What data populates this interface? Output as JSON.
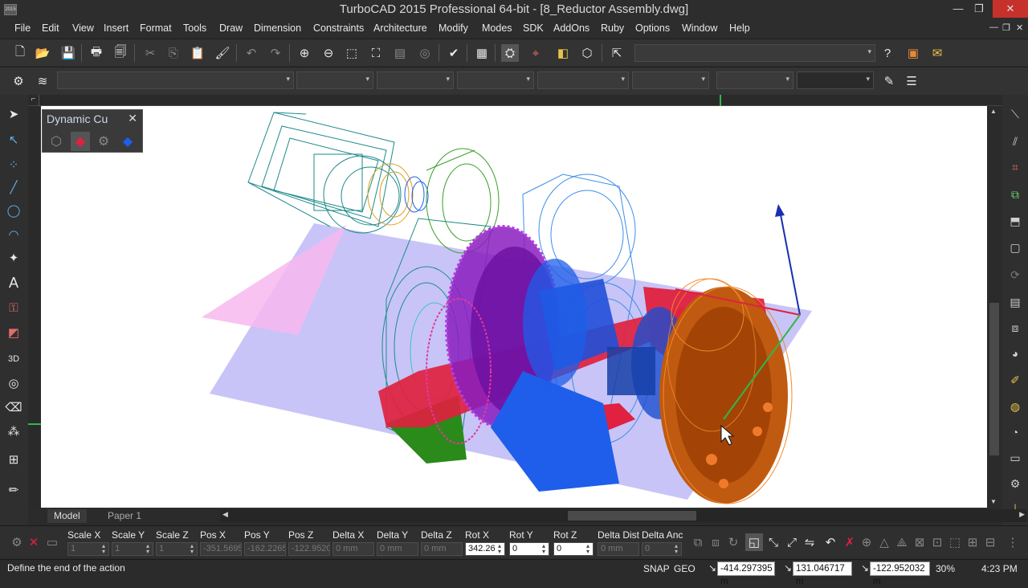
{
  "window": {
    "title": "TurboCAD 2015 Professional 64-bit - [8_Reductor Assembly.dwg]",
    "app_icon_text": "2015",
    "minimize": "—",
    "maximize": "❐",
    "close": "✕"
  },
  "menu": {
    "items": [
      "File",
      "Edit",
      "View",
      "Insert",
      "Format",
      "Tools",
      "Draw",
      "Dimension",
      "Constraints",
      "Architecture",
      "Modify",
      "Modes",
      "SDK",
      "AddOns",
      "Ruby",
      "Options",
      "Window",
      "Help"
    ],
    "mdi_minimize": "—",
    "mdi_restore": "❐",
    "mdi_close": "✕"
  },
  "palette": {
    "title": "Dynamic Cu",
    "close": "✕"
  },
  "tabs": {
    "model": "Model",
    "paper1": "Paper 1"
  },
  "inspector": {
    "labels": [
      "Scale X",
      "Scale Y",
      "Scale Z",
      "Pos X",
      "Pos Y",
      "Pos Z",
      "Delta X",
      "Delta Y",
      "Delta Z",
      "Rot X",
      "Rot Y",
      "Rot Z",
      "Delta Dist",
      "Delta Anc"
    ],
    "values": [
      "1",
      "1",
      "1",
      "-351.5695",
      "-162.2265",
      "-122.9520",
      "0 mm",
      "0 mm",
      "0 mm",
      "342.26",
      "0",
      "0",
      "0 mm",
      "0"
    ]
  },
  "status": {
    "message": "Define the end of the action",
    "snap": "SNAP",
    "geo": "GEO",
    "x": "-414.297395 m",
    "y": "131.046717 m",
    "z": "-122.952032 m",
    "zoom": "30%",
    "time": "4:23 PM"
  },
  "colors": {
    "chrome": "#2d2d2d",
    "canvas": "#ffffff",
    "close_red": "#c7312b",
    "gear_cyan": "#1d8a8a",
    "gear_magenta": "#8a1dbf",
    "gear_blue": "#1e5eea",
    "part_red": "#e0213f",
    "flange_orange": "#c05a10",
    "plane_lilac": "#b9b4f5",
    "plane_pink": "#f7b8ee"
  }
}
